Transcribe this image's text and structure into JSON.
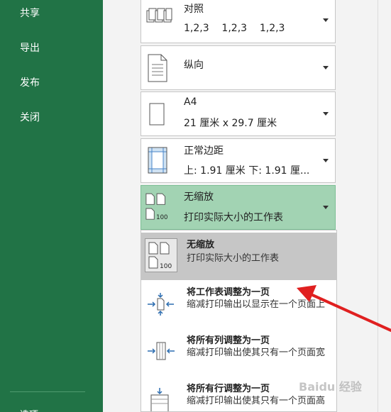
{
  "sidebar": {
    "items": [
      "共享",
      "导出",
      "发布",
      "关闭"
    ],
    "bottom_partial": "选项"
  },
  "settings": {
    "collate": {
      "title": "对照",
      "value": "1,2,3    1,2,3    1,2,3",
      "icon": "collate-icon"
    },
    "orientation": {
      "title": "纵向",
      "icon": "portrait-page-icon"
    },
    "paper": {
      "title": "A4",
      "value": "21 厘米 x 29.7 厘米",
      "icon": "paper-size-icon"
    },
    "margins": {
      "title": "正常边距",
      "value": "上: 1.91 厘米 下: 1.91 厘...",
      "icon": "margins-icon"
    },
    "scaling": {
      "title": "无缩放",
      "value": "打印实际大小的工作表",
      "icon": "no-scaling-icon"
    }
  },
  "scaling_menu": [
    {
      "title": "无缩放",
      "desc": "打印实际大小的工作表",
      "icon": "no-scaling-icon",
      "selected": true
    },
    {
      "title": "将工作表调整为一页",
      "desc": "缩减打印输出以显示在一个页面上",
      "icon": "fit-sheet-icon"
    },
    {
      "title": "将所有列调整为一页",
      "desc": "缩减打印输出使其只有一个页面宽",
      "icon": "fit-columns-icon"
    },
    {
      "title": "将所有行调整为一页",
      "desc": "缩减打印输出使其只有一个页面高",
      "icon": "fit-rows-icon"
    }
  ],
  "watermark": "Baidu 经验",
  "colors": {
    "sidebar": "#217346",
    "highlight": "#a2d3b3",
    "selected": "#c6c6c6",
    "arrow": "#e02020"
  }
}
